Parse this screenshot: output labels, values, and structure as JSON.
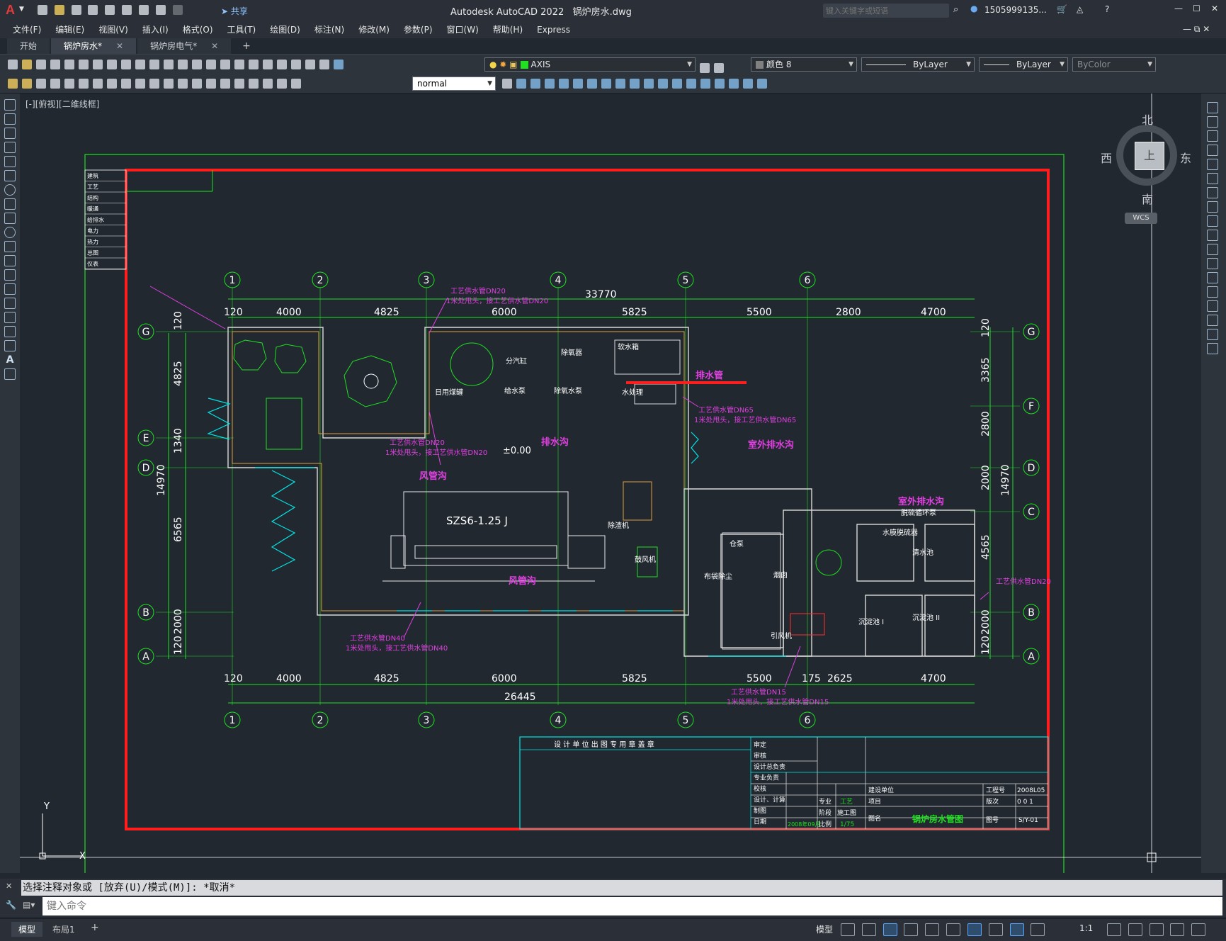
{
  "app": {
    "title": "Autodesk AutoCAD 2022",
    "filename": "锅炉房水.dwg",
    "share_label": "共享",
    "search_placeholder": "键入关键字或短语",
    "user_id": "1505999135..."
  },
  "menu": [
    "文件(F)",
    "编辑(E)",
    "视图(V)",
    "插入(I)",
    "格式(O)",
    "工具(T)",
    "绘图(D)",
    "标注(N)",
    "修改(M)",
    "参数(P)",
    "窗口(W)",
    "帮助(H)",
    "Express"
  ],
  "tabs": [
    {
      "label": "开始",
      "active": false,
      "closable": false
    },
    {
      "label": "锅炉房水*",
      "active": true,
      "closable": true
    },
    {
      "label": "锅炉房电气*",
      "active": false,
      "closable": true
    }
  ],
  "toolbar": {
    "layer_name": "AXIS",
    "color": "颜色 8",
    "linetype": "ByLayer",
    "lineweight": "ByLayer",
    "plotstyle": "ByColor",
    "dimstyle": "normal"
  },
  "viewport_label": "[-][俯视][二维线框]",
  "viewcube": {
    "n": "北",
    "s": "南",
    "e": "东",
    "w": "西",
    "face": "上",
    "wcs": "WCS"
  },
  "drawing": {
    "legend_rows": [
      "建筑",
      "工艺",
      "结构",
      "暖通",
      "给排水",
      "电力",
      "热力",
      "总图",
      "仪表"
    ],
    "axis_cols_top": [
      "1",
      "2",
      "3",
      "4",
      "5",
      "6"
    ],
    "axis_rows_left": [
      "G",
      "E",
      "D",
      "B",
      "A"
    ],
    "axis_rows_right": [
      "G",
      "F",
      "D",
      "C",
      "B",
      "A"
    ],
    "total_top": "33770",
    "total_bottom": "26445",
    "dims_top": [
      "120",
      "4000",
      "4825",
      "6000",
      "5825",
      "5500",
      "2800",
      "4700"
    ],
    "dims_bottom": [
      "120",
      "4000",
      "4825",
      "6000",
      "5825",
      "5500",
      "175",
      "2625",
      "4700"
    ],
    "dims_left": [
      "120",
      "4825",
      "1340",
      "6565",
      "2000",
      "120",
      "14970"
    ],
    "dims_right": [
      "120",
      "3365",
      "2800",
      "2000",
      "4565",
      "2000",
      "120",
      "14970"
    ],
    "boiler_label": "SZS6-1.25  J",
    "level": "±0.00",
    "labels_magenta": [
      "排水管",
      "排水沟",
      "风管沟",
      "风管沟",
      "室外排水沟",
      "室外排水沟"
    ],
    "pipe_notes": [
      {
        "a": "工艺供水管DN20",
        "b": "1米处甩头，接工艺供水管DN20"
      },
      {
        "a": "工艺供水管DN65",
        "b": "1米处甩头，接工艺供水管DN65"
      },
      {
        "a": "工艺供水管DN20",
        "b": "1米处甩头，接工艺供水管DN20"
      },
      {
        "a": "工艺供水管DN40",
        "b": "1米处甩头，接工艺供水管DN40"
      },
      {
        "a": "工艺供水管DN15",
        "b": "1米处甩头，接工艺供水管DN15"
      },
      {
        "a": "工艺供水管DN20",
        "b": ""
      }
    ],
    "rooms": [
      "软水箱",
      "日用煤罐",
      "给水泵",
      "除氧水泵",
      "水处理",
      "除渣机",
      "鼓风机",
      "仓泵",
      "布袋除尘",
      "烟囱",
      "引风机",
      "脱硫循环泵",
      "清水池",
      "沉淀池 I",
      "沉淀池 II",
      "水膜脱硫器",
      "分汽缸",
      "除氧器"
    ],
    "title_block": {
      "stamp_header": "设 计 单 位 出 图 专 用 章 盖 章",
      "rows_left": [
        "审定",
        "审核",
        "设计总负责",
        "专业负责",
        "校核",
        "设计、计算",
        "制图",
        "日期"
      ],
      "date": "2008年09月",
      "specialty_label": "专业",
      "specialty": "工艺",
      "stage_label": "阶段",
      "stage": "施工图",
      "scale_label": "比例",
      "scale": "1/75",
      "client_label": "建设单位",
      "project_label": "项目",
      "drawing_name_label": "图名",
      "drawing_name": "锅炉房水管图",
      "project_no_label": "工程号",
      "project_no": "2008L05",
      "version_label": "版次",
      "version": "0 0 1",
      "sheet_label": "图号",
      "sheet_no": "S/Y-01"
    }
  },
  "command": {
    "history": "选择注释对象或 [放弃(U)/模式(M)]: *取消*",
    "placeholder": "键入命令"
  },
  "layout_tabs": [
    "模型",
    "布局1"
  ],
  "status": {
    "model": "模型",
    "scale": "1:1"
  }
}
